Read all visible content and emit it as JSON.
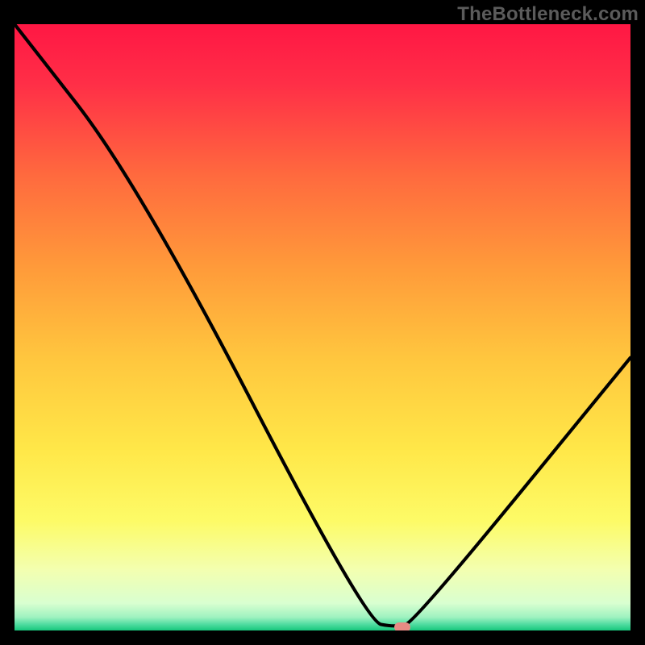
{
  "watermark": "TheBottleneck.com",
  "chart_data": {
    "type": "line",
    "title": "",
    "xlabel": "",
    "ylabel": "",
    "xlim": [
      0,
      100
    ],
    "ylim": [
      0,
      100
    ],
    "series": [
      {
        "name": "bottleneck-curve",
        "x": [
          0,
          20,
          57,
          62,
          65,
          100
        ],
        "values": [
          100,
          74,
          1.5,
          0.5,
          1.5,
          45
        ]
      }
    ],
    "marker": {
      "x": 63,
      "y": 0.5
    },
    "gradient_stops": [
      {
        "pos": 0.0,
        "color": "#ff1744"
      },
      {
        "pos": 0.1,
        "color": "#ff2f47"
      },
      {
        "pos": 0.25,
        "color": "#ff6a3e"
      },
      {
        "pos": 0.4,
        "color": "#ff9a3a"
      },
      {
        "pos": 0.55,
        "color": "#ffc63e"
      },
      {
        "pos": 0.7,
        "color": "#ffe748"
      },
      {
        "pos": 0.82,
        "color": "#fdfb67"
      },
      {
        "pos": 0.9,
        "color": "#f3ffb0"
      },
      {
        "pos": 0.955,
        "color": "#d9ffd0"
      },
      {
        "pos": 0.978,
        "color": "#9ff2c0"
      },
      {
        "pos": 0.99,
        "color": "#4fdca0"
      },
      {
        "pos": 1.0,
        "color": "#16c77c"
      }
    ]
  }
}
